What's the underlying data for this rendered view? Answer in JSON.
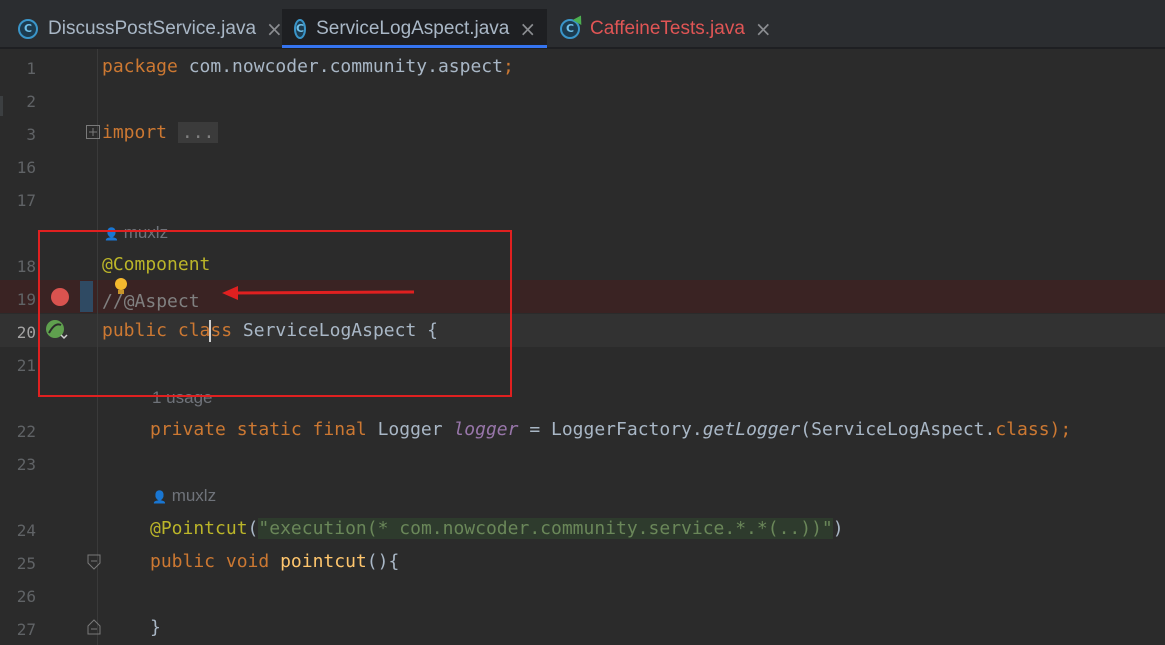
{
  "tabs": [
    {
      "label": "DiscussPostService.java",
      "active": false
    },
    {
      "label": "ServiceLogAspect.java",
      "active": true
    },
    {
      "label": "CaffeineTests.java",
      "active": false
    }
  ],
  "tab_close_glyph": "×",
  "class_icon_letter": "C",
  "lines": {
    "n1": "1",
    "n2": "2",
    "n3": "3",
    "n16": "16",
    "n17": "17",
    "n18": "18",
    "n19": "19",
    "n20": "20",
    "n21": "21",
    "n22": "22",
    "n23": "23",
    "n24": "24",
    "n25": "25",
    "n26": "26",
    "n27": "27"
  },
  "code": {
    "l1_kw": "package",
    "l1_rest": " com.nowcoder.community.aspect",
    "l1_semi": ";",
    "l3_kw": "import",
    "l3_fold": "...",
    "author": "muxlz",
    "l18": "@Component",
    "l19_a": "/",
    "l19_b": "/",
    "l19_c": "@Aspect",
    "l20_kw1": "public",
    "l20_kw2": "cla",
    "l20_kw3": "ss",
    "l20_rest": " ServiceLogAspect {",
    "usage": "1 usage",
    "l22_kw": "private static final",
    "l22_type": " Logger ",
    "l22_field": "logger",
    "l22_eq": " = LoggerFactory.",
    "l22_method": "getLogger",
    "l22_arg": "(ServiceLogAspect.",
    "l22_class": "class",
    "l22_end": ");",
    "l24_ann": "@Pointcut",
    "l24_open": "(",
    "l24_str": "\"execution(* com.nowcoder.community.service.*.*(..))\"",
    "l24_close": ")",
    "l25_kw": "public void",
    "l25_fn": "pointcut",
    "l25_end": "(){",
    "l27": "}"
  },
  "colors": {
    "highlight_box": "#e02020",
    "arrow": "#e02020",
    "breakpoint": "#d9534f",
    "spring_bean": "#5fa04e",
    "tab_accent": "#3574f0"
  }
}
